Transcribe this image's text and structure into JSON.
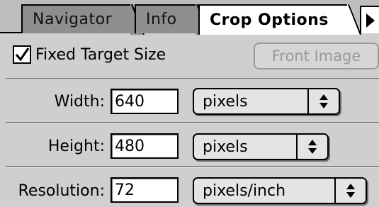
{
  "tabs": [
    {
      "label": "Navigator",
      "active": false
    },
    {
      "label": "Info",
      "active": false
    },
    {
      "label": "Crop Options",
      "active": true
    }
  ],
  "tab_menu_icon": "triangle-right-icon",
  "fixed_target": {
    "label": "Fixed Target Size",
    "checked": true
  },
  "front_image_button": {
    "label": "Front Image",
    "enabled": false
  },
  "fields": {
    "width": {
      "label": "Width:",
      "value": "640",
      "unit": "pixels"
    },
    "height": {
      "label": "Height:",
      "value": "480",
      "unit": "pixels"
    },
    "resolution": {
      "label": "Resolution:",
      "value": "72",
      "unit": "pixels/inch"
    }
  },
  "colors": {
    "panel": "#cfcfcf",
    "inactive_tab": "#8e8e8e",
    "active_tab": "#ffffff"
  }
}
